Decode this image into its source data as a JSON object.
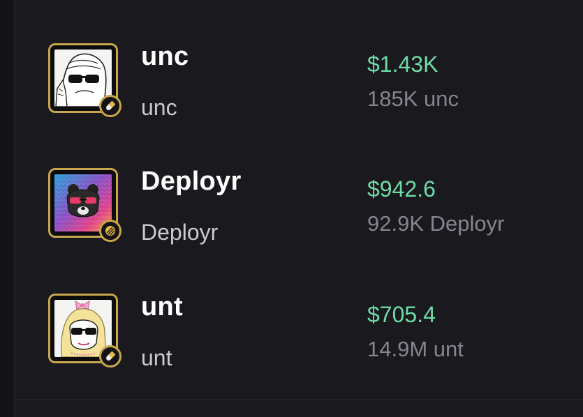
{
  "colors": {
    "background": "#19191e",
    "accent_gold": "#c8a64c",
    "value_green": "#6fdba6",
    "secondary_text": "#85858f"
  },
  "tokens": [
    {
      "name": "unc",
      "symbol": "unc",
      "value": "$1.43K",
      "amount": "185K unc",
      "avatar_icon": "unc-meme-avatar",
      "badge_icon": "pill-icon"
    },
    {
      "name": "Deployr",
      "symbol": "Deployr",
      "value": "$942.6",
      "amount": "92.9K Deployr",
      "avatar_icon": "bear-sunglasses-avatar",
      "badge_icon": "stripes-icon"
    },
    {
      "name": "unt",
      "symbol": "unt",
      "value": "$705.4",
      "amount": "14.9M unt",
      "avatar_icon": "unt-meme-avatar",
      "badge_icon": "pill-icon"
    }
  ]
}
